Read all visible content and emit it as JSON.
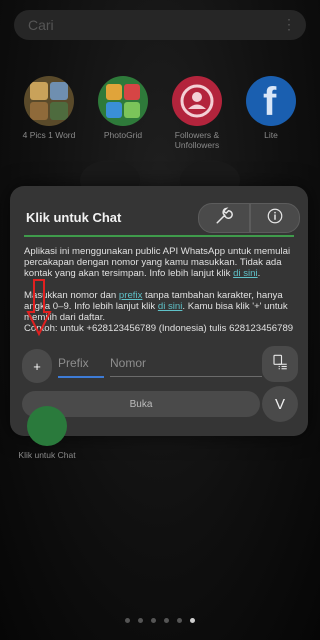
{
  "home": {
    "search": {
      "placeholder": "Cari"
    },
    "apps": [
      {
        "label": "4 Pics 1 Word",
        "icon": "four-pics-icon"
      },
      {
        "label": "PhotoGrid",
        "icon": "photogrid-icon"
      },
      {
        "label": "Followers & Unfollowers",
        "icon": "followers-icon"
      },
      {
        "label": "Lite",
        "icon": "facebook-lite-icon"
      }
    ],
    "bottom_app": {
      "label": "Klik untuk Chat",
      "icon": "chat-app-icon"
    },
    "page_dots": {
      "count": 6,
      "active_index": 5
    }
  },
  "dialog": {
    "title": "Klik untuk Chat",
    "accent_color": "#3f9b4b",
    "link_color": "#5fc2c9",
    "paragraph1": "Aplikasi ini menggunakan public API WhatsApp untuk memulai percakapan dengan nomor yang kamu masukkan. Tidak ada kontak yang akan tersimpan.",
    "info1_prefix": "Info lebih lanjut klik ",
    "link_here": "di sini",
    "period": ".",
    "p2_part1": "Masukkan nomor dan ",
    "link_prefix": "prefix",
    "p2_part2": " tanpa tambahan karakter, hanya angka 0–9. Info lebih lanjut klik ",
    "p2_part3": ". Kamu bisa klik '+' untuk memilih dari daftar.",
    "example": "Contoh: untuk +628123456789 (Indonesia) tulis 628123456789",
    "plus_label": "+",
    "prefix_placeholder": "Prefix",
    "number_placeholder": "Nomor",
    "open_label": "Buka",
    "expand_label": "V"
  }
}
